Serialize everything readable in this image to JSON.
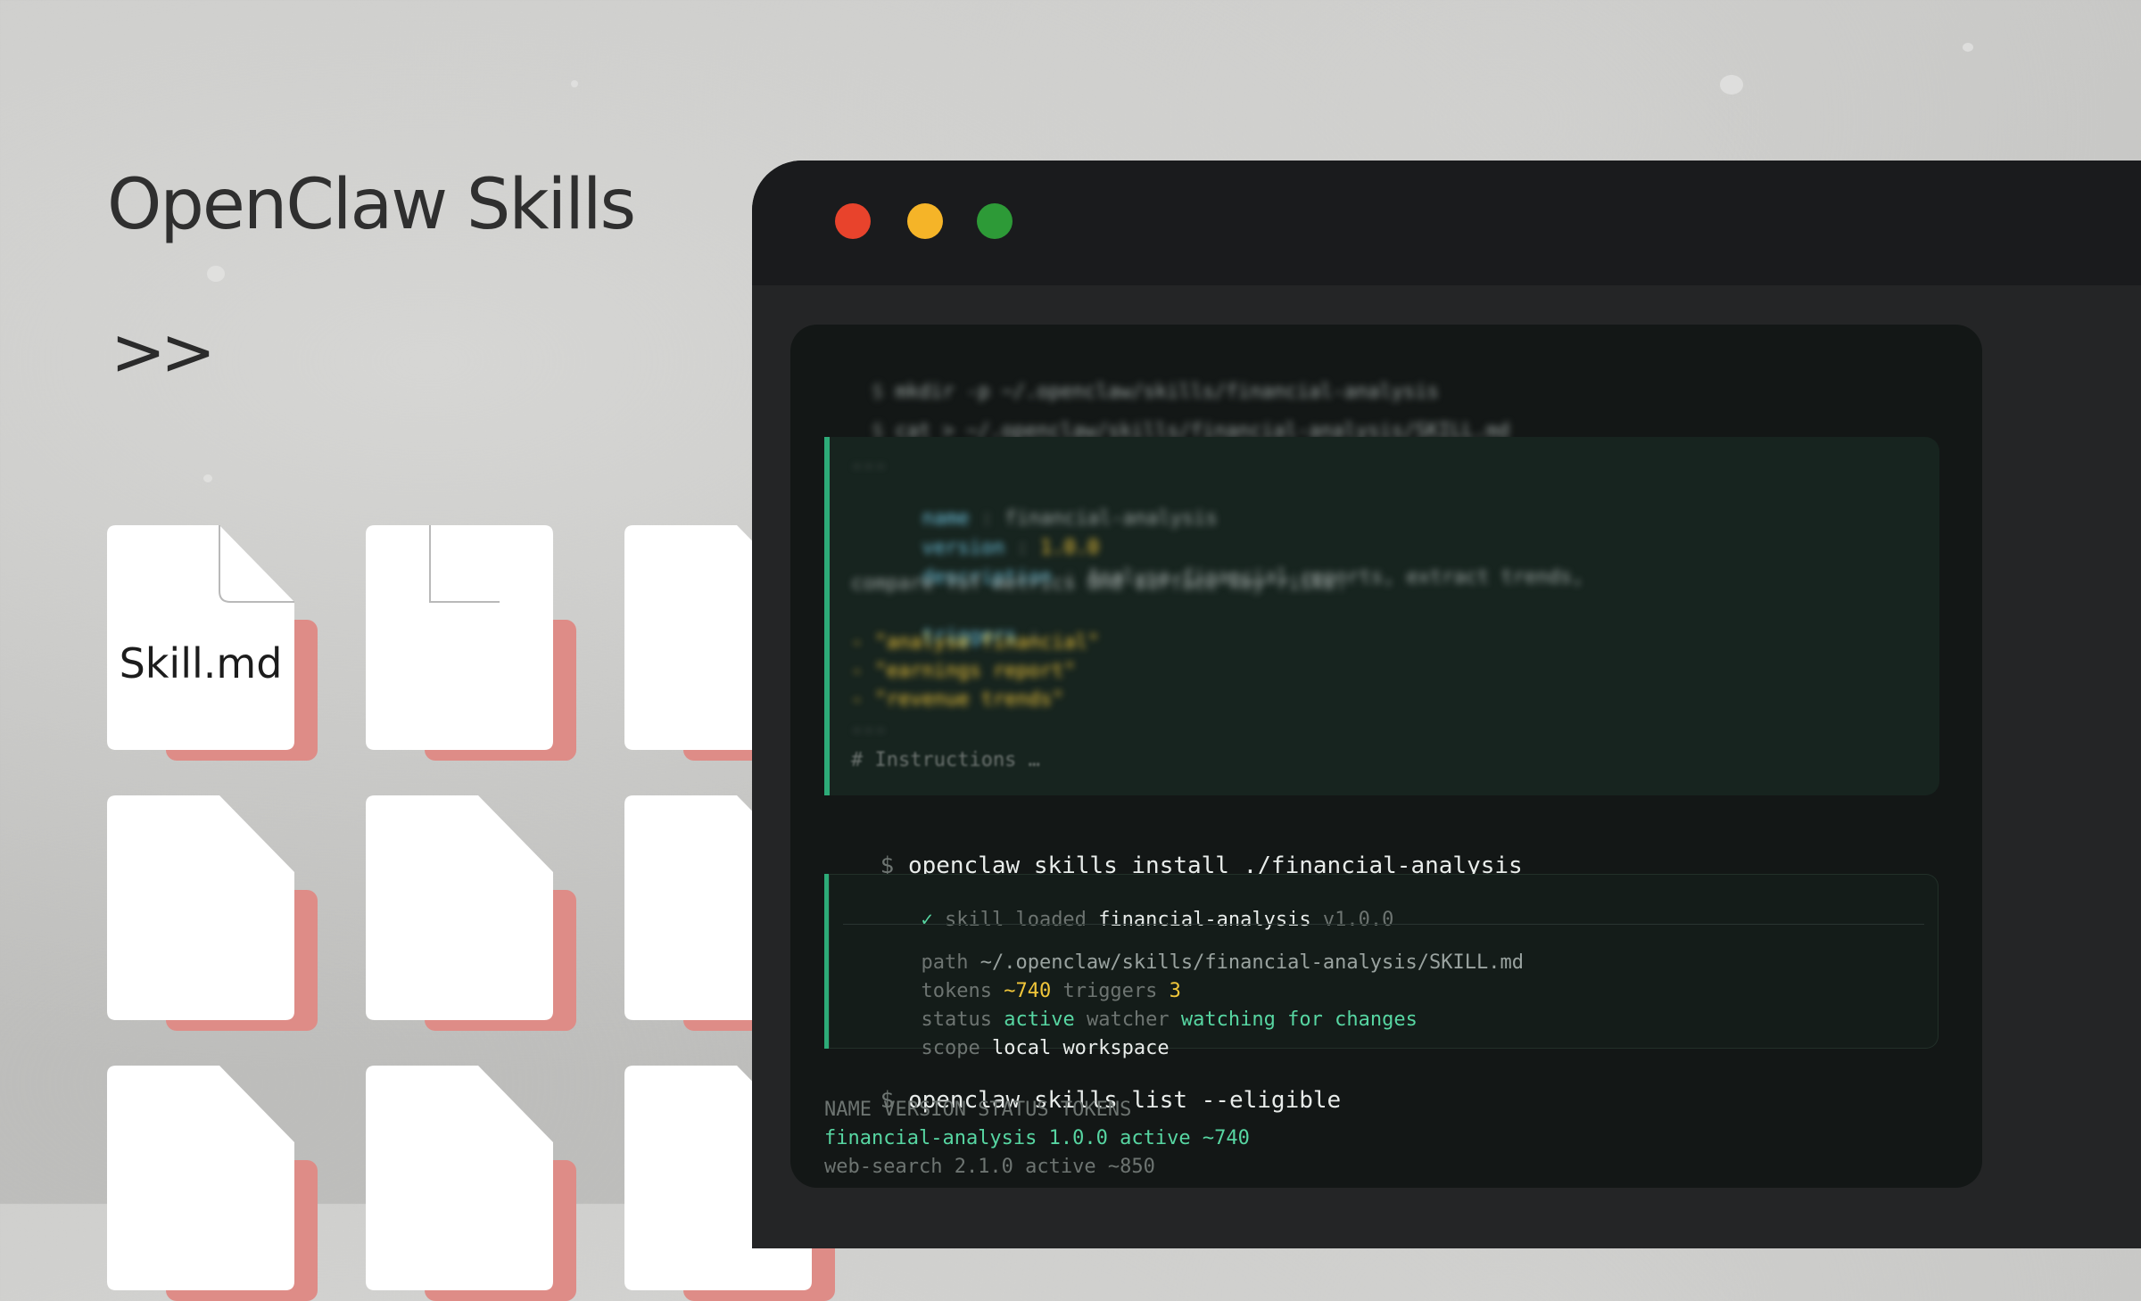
{
  "hero": {
    "title": "OpenClaw Skills",
    "chevrons": ">>"
  },
  "files": {
    "first_label": "Skill.md"
  },
  "window": {
    "buttons": {
      "close_color": "#e8432c",
      "minimize_color": "#f5b428",
      "maximize_color": "#2d9a37"
    }
  },
  "terminal": {
    "prompt": "$",
    "blurred": {
      "cmd1": "mkdir -p ~/.openclaw/skills/financial-analysis",
      "cmd2": "cat > ~/.openclaw/skills/financial-analysis/SKILL.md",
      "yaml_open": "---",
      "name_key": "name",
      "name_val": "financial-analysis",
      "version_key": "version",
      "version_val": "1.0.0",
      "desc_key": "description",
      "desc_val": "Analyse financial reports, extract trends,",
      "desc_val2": "compare YoY metrics and surface key risks.",
      "triggers_key": "triggers",
      "trigger1": "- \"analyse financial\"",
      "trigger2": "- \"earnings report\"",
      "trigger3": "- \"revenue trends\"",
      "yaml_close": "---",
      "instructions": "# Instructions …"
    },
    "install_cmd": "openclaw skills install ./financial-analysis",
    "result": {
      "check": "✓",
      "loaded_label": "skill loaded",
      "loaded_name": "financial-analysis",
      "loaded_version": "v1.0.0",
      "path_label": "path",
      "path_value": "~/.openclaw/skills/financial-analysis/SKILL.md",
      "tokens_label": "tokens",
      "tokens_value": "~740",
      "triggers_label": "triggers",
      "triggers_value": "3",
      "status_label": "status",
      "status_value": "active",
      "watcher_label": "watcher",
      "watcher_value": "watching for changes",
      "scope_label": "scope",
      "scope_value": "local workspace"
    },
    "list_cmd": "openclaw skills list --eligible",
    "table": {
      "header": "NAME VERSION STATUS TOKENS",
      "row1": "financial-analysis 1.0.0 active ~740",
      "row2": "web-search 2.1.0 active ~850"
    }
  }
}
